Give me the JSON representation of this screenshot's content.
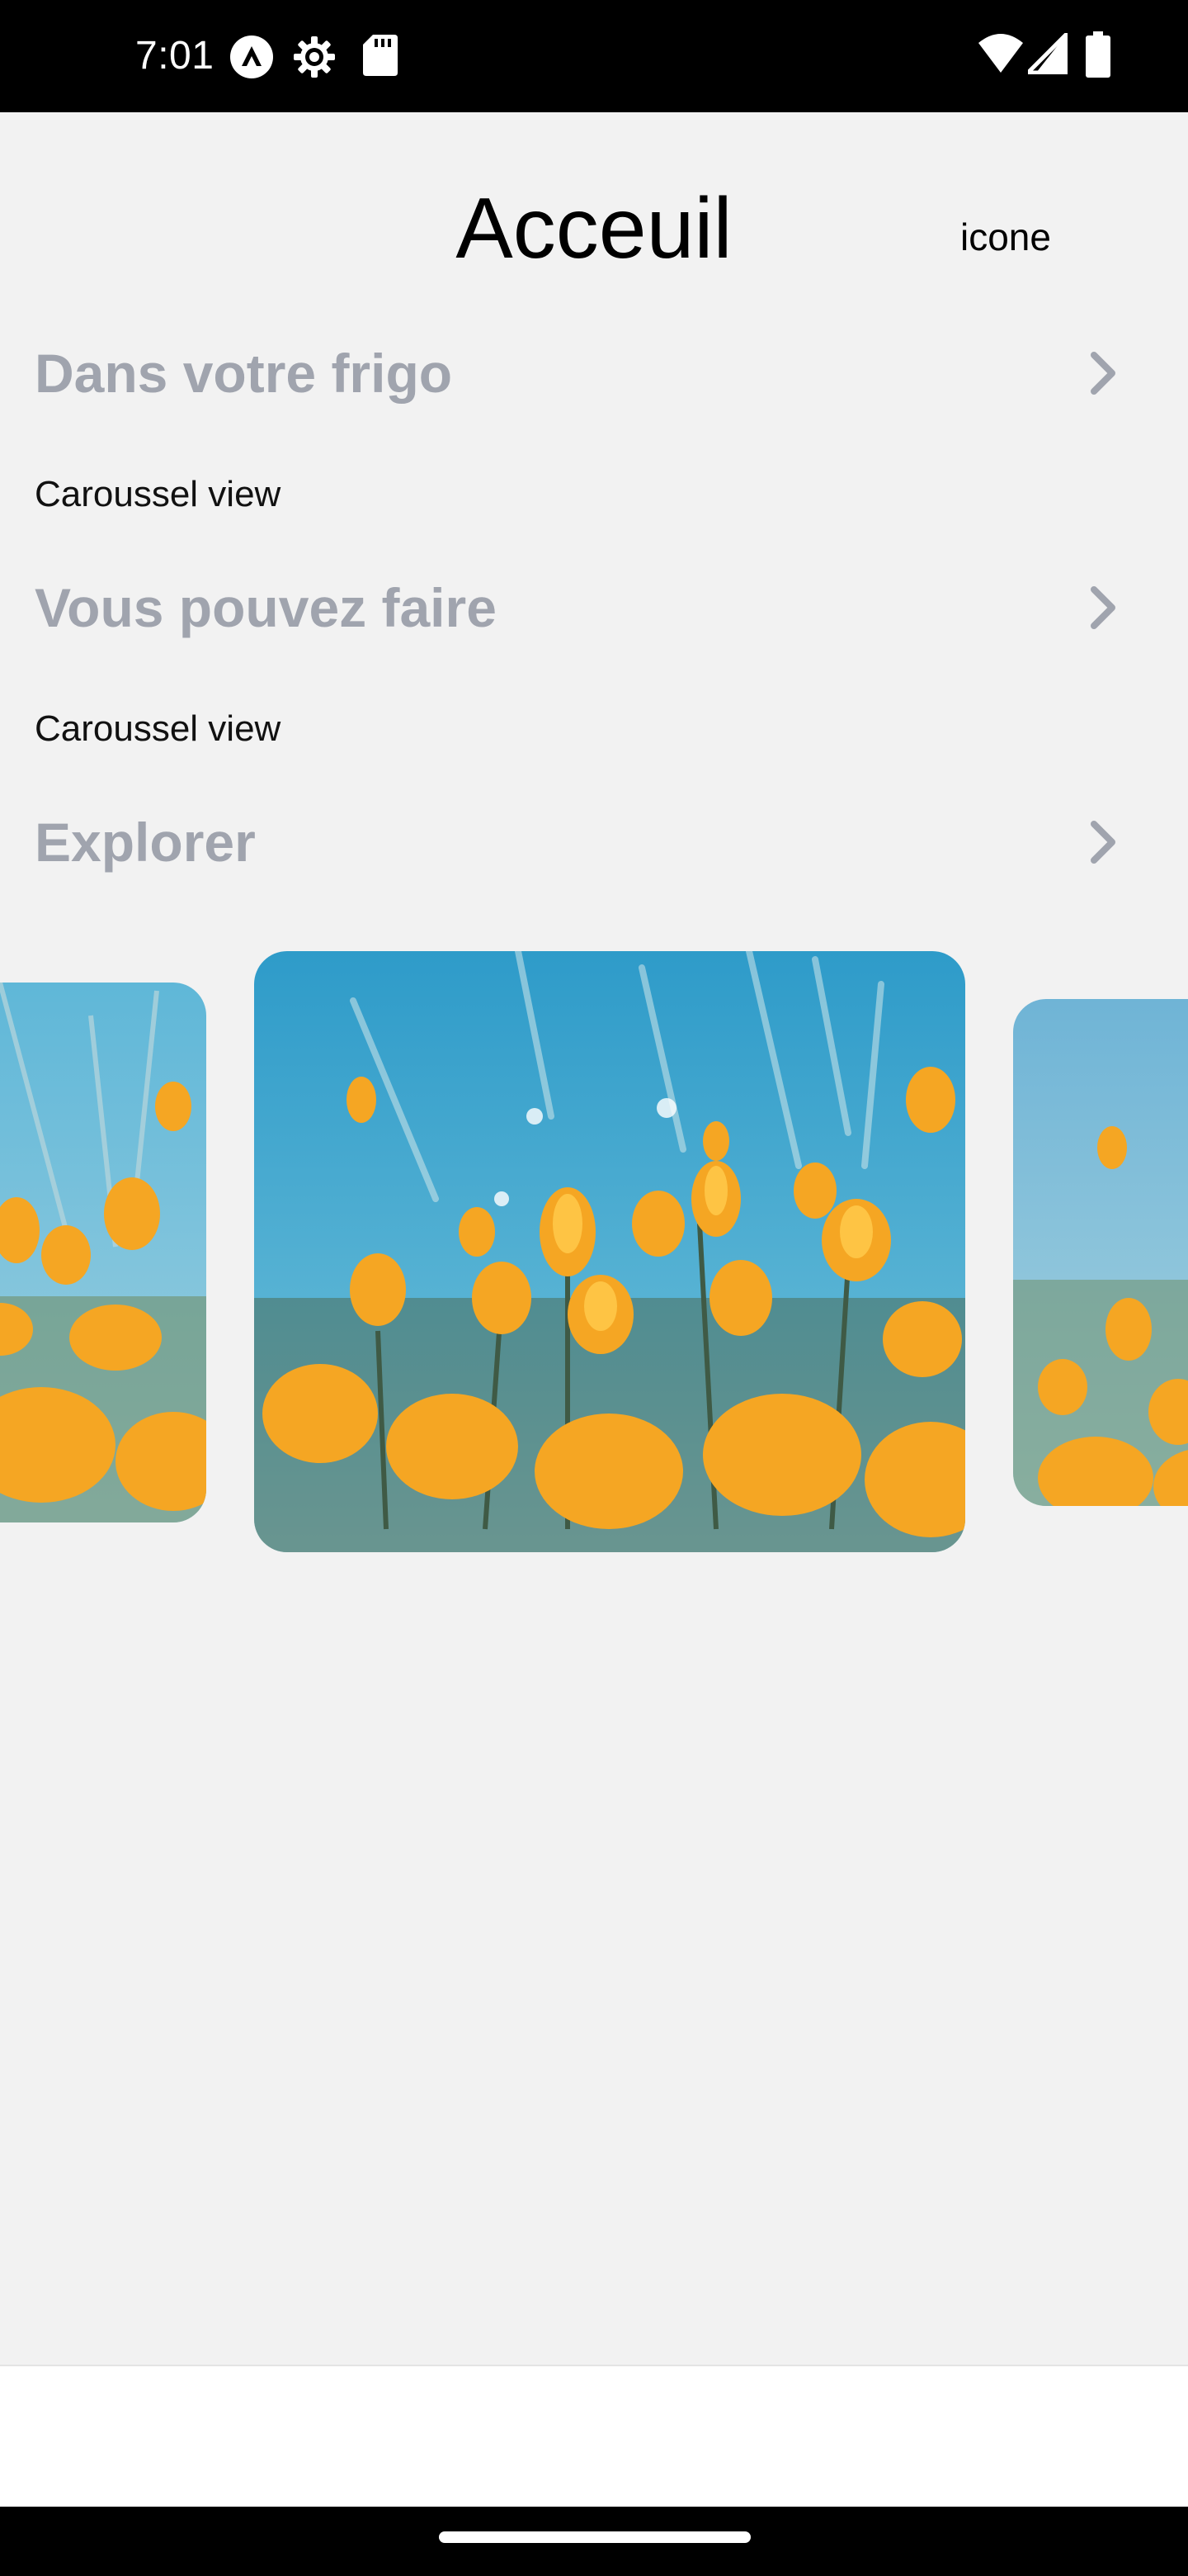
{
  "status_bar": {
    "time": "7:01",
    "left_icons": [
      "arrow-up-circle-icon",
      "settings-gear-icon",
      "sd-card-icon"
    ],
    "right_icons": [
      "wifi-icon",
      "signal-icon",
      "battery-icon"
    ]
  },
  "header": {
    "title": "Acceuil",
    "icon_label": "icone"
  },
  "sections": [
    {
      "title": "Dans votre frigo",
      "content": "Caroussel view",
      "chevron_icon": "chevron-right-icon"
    },
    {
      "title": "Vous pouvez faire",
      "content": "Caroussel view",
      "chevron_icon": "chevron-right-icon"
    },
    {
      "title": "Explorer",
      "chevron_icon": "chevron-right-icon"
    }
  ],
  "carousel": {
    "items": [
      {
        "image": "yellow-poppies-flower-field-photo"
      },
      {
        "image": "yellow-poppies-flower-field-photo"
      },
      {
        "image": "yellow-poppies-flower-field-photo"
      }
    ]
  },
  "colors": {
    "background": "#f2f2f2",
    "section_title": "#a0a4ae",
    "status_bar": "#000000",
    "sky": "#3aa0cc",
    "flower": "#f5a623"
  }
}
